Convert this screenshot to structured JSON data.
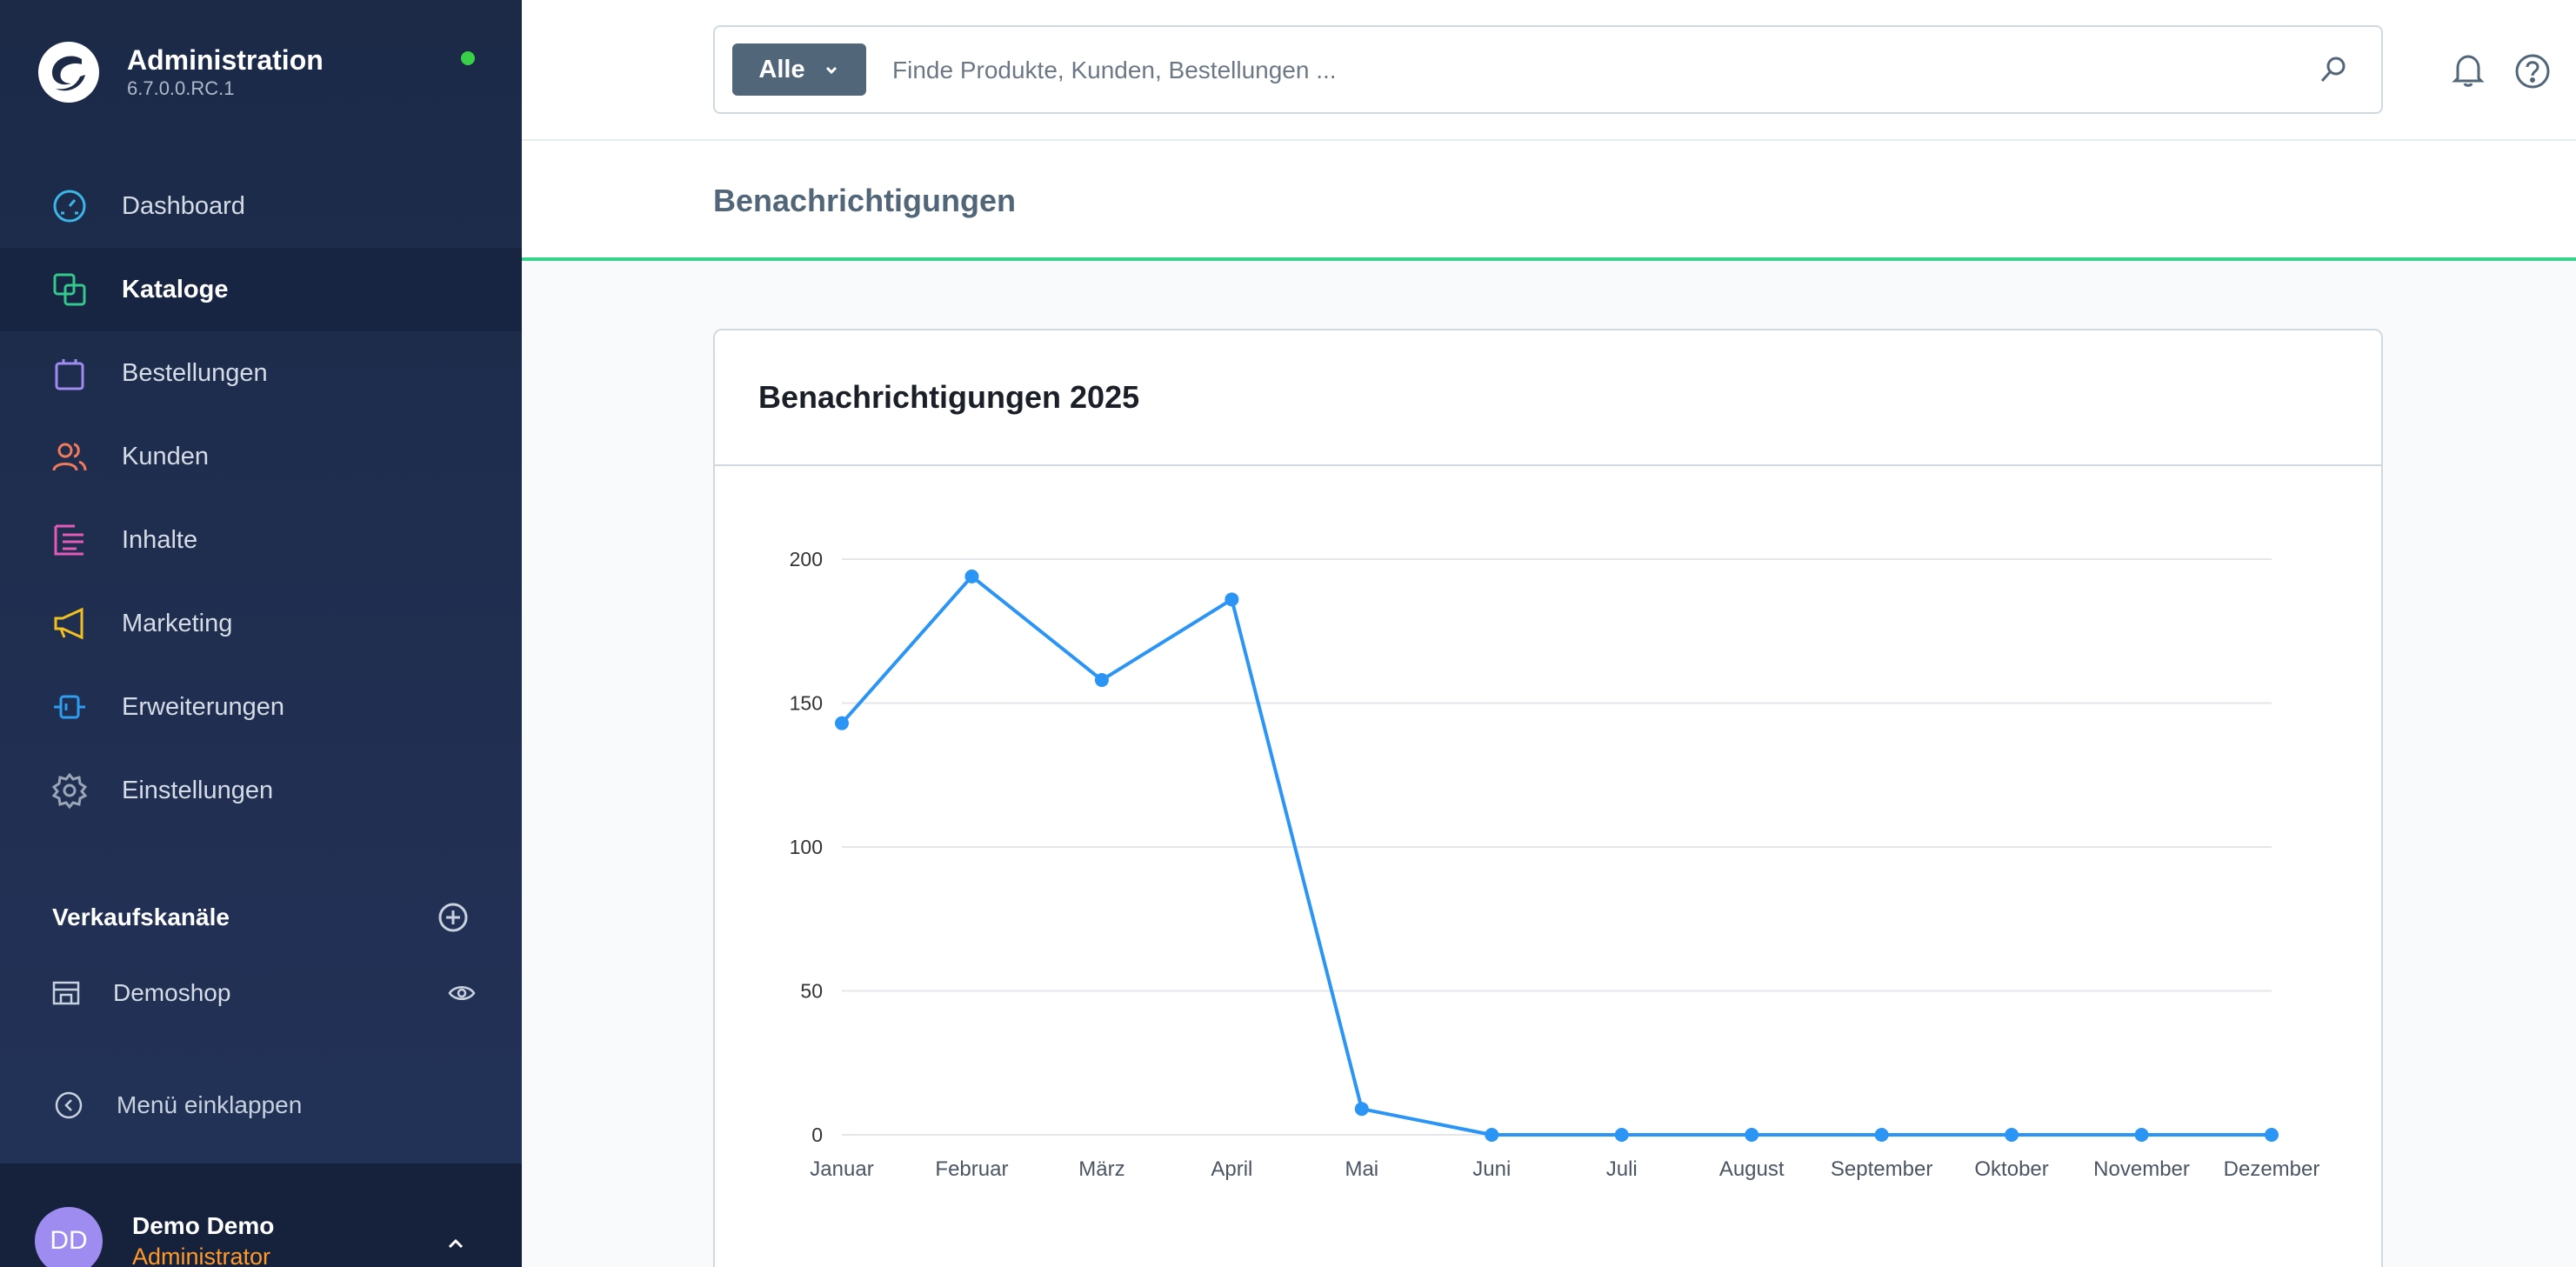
{
  "app": {
    "title": "Administration",
    "version": "6.7.0.0.RC.1",
    "status_color": "#37d046"
  },
  "sidebar": {
    "items": [
      {
        "label": "Dashboard",
        "icon": "dashboard-icon",
        "color": "#3bb6e6"
      },
      {
        "label": "Kataloge",
        "icon": "catalog-icon",
        "color": "#35c88c",
        "active": true
      },
      {
        "label": "Bestellungen",
        "icon": "orders-icon",
        "color": "#9f8cf0"
      },
      {
        "label": "Kunden",
        "icon": "customers-icon",
        "color": "#f07a5a"
      },
      {
        "label": "Inhalte",
        "icon": "content-icon",
        "color": "#e35ab8"
      },
      {
        "label": "Marketing",
        "icon": "marketing-icon",
        "color": "#f0c020"
      },
      {
        "label": "Erweiterungen",
        "icon": "extensions-icon",
        "color": "#2d9ef0"
      },
      {
        "label": "Einstellungen",
        "icon": "settings-icon",
        "color": "#9aa6b6"
      }
    ],
    "sales_channels_title": "Verkaufskanäle",
    "sales_channel": "Demoshop",
    "collapse_label": "Menü einklappen"
  },
  "user": {
    "initials": "DD",
    "name": "Demo Demo",
    "role": "Administrator"
  },
  "search": {
    "type_label": "Alle",
    "placeholder": "Finde Produkte, Kunden, Bestellungen ..."
  },
  "page": {
    "title": "Benachrichtigungen"
  },
  "card": {
    "title": "Benachrichtigungen 2025"
  },
  "chart_data": {
    "type": "line",
    "categories": [
      "Januar",
      "Februar",
      "März",
      "April",
      "Mai",
      "Juni",
      "Juli",
      "August",
      "September",
      "Oktober",
      "November",
      "Dezember"
    ],
    "series": [
      {
        "values": [
          143,
          194,
          158,
          186,
          9,
          0,
          0,
          0,
          0,
          0,
          0,
          0
        ],
        "color": "#2b95f5"
      }
    ],
    "yticks": [
      0,
      50,
      100,
      150,
      200
    ],
    "ylim": [
      0,
      200
    ],
    "grid": true
  }
}
